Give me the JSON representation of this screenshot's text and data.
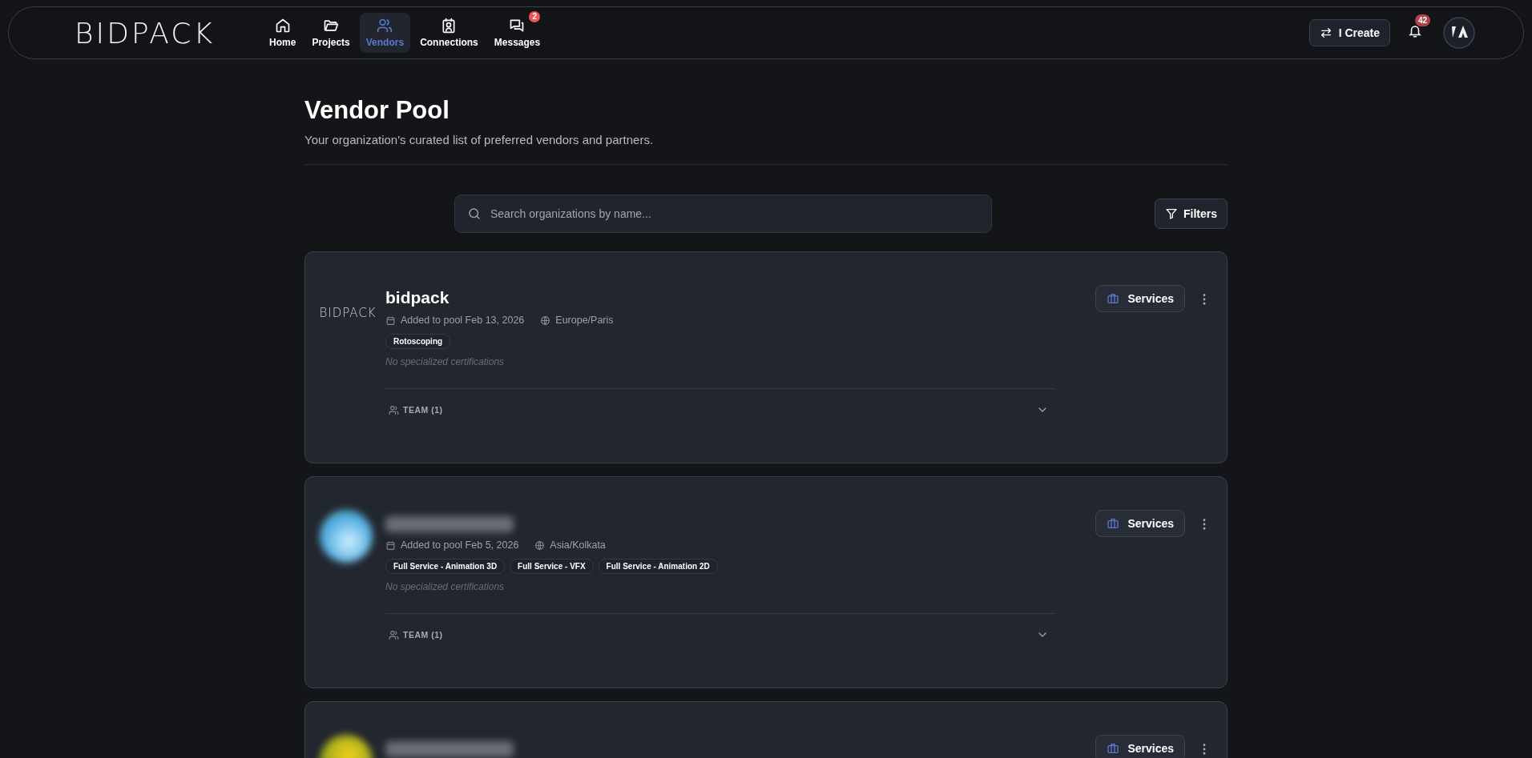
{
  "header": {
    "logo": "BIDPACK",
    "nav": [
      {
        "label": "Home",
        "selected": false
      },
      {
        "label": "Projects",
        "selected": false
      },
      {
        "label": "Vendors",
        "selected": true
      },
      {
        "label": "Connections",
        "selected": false
      },
      {
        "label": "Messages",
        "selected": false,
        "badge": "2"
      }
    ],
    "create_button": "I Create",
    "notification_count": "42"
  },
  "page": {
    "title": "Vendor Pool",
    "subtitle": "Your organization's curated list of preferred vendors and partners."
  },
  "search": {
    "placeholder": "Search organizations by name..."
  },
  "filters_button": "Filters",
  "vendors": [
    {
      "logo": {
        "kind": "wordmark",
        "text": "BIDPACK"
      },
      "name": "bidpack",
      "added": "Added to pool Feb 13, 2026",
      "timezone": "Europe/Paris",
      "tags": [
        "Rotoscoping"
      ],
      "certifications": "No specialized certifications",
      "team": "TEAM (1)",
      "services": "Services"
    },
    {
      "logo": {
        "kind": "photo"
      },
      "added": "Added to pool Feb 5, 2026",
      "timezone": "Asia/Kolkata",
      "tags": [
        "Full Service - Animation 3D",
        "Full Service - VFX",
        "Full Service - Animation 2D"
      ],
      "certifications": "No specialized certifications",
      "team": "TEAM (1)",
      "services": "Services"
    },
    {
      "logo": {
        "kind": "photo2"
      },
      "services": "Services"
    }
  ]
}
